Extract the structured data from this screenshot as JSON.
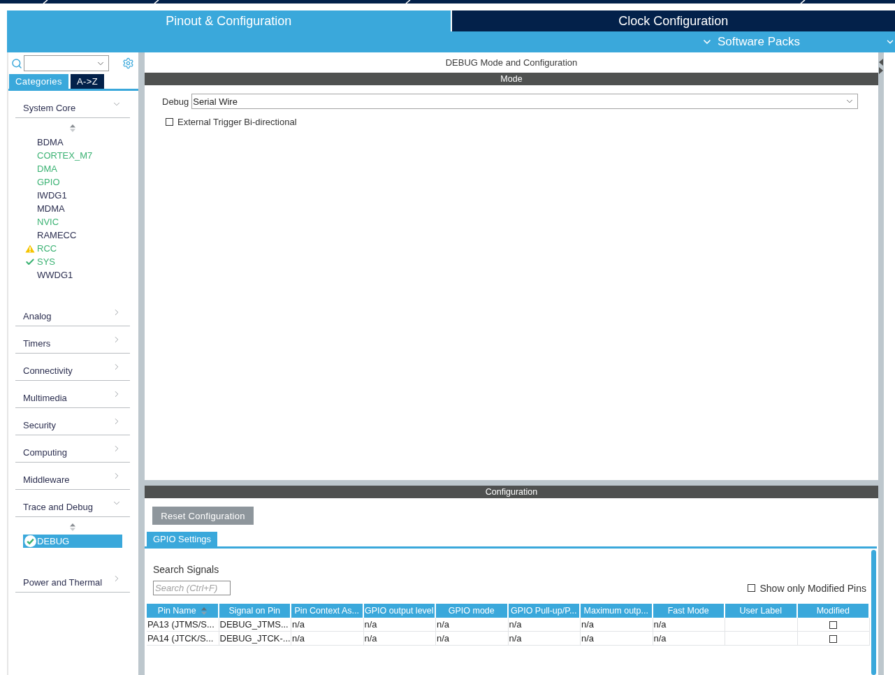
{
  "top_tabs": [
    {
      "label": "Pinout & Configuration",
      "selected": true
    },
    {
      "label": "Clock Configuration",
      "selected": false
    }
  ],
  "menu": {
    "label": "Software Packs"
  },
  "sidebar": {
    "view_tabs": [
      {
        "label": "Categories",
        "selected": true
      },
      {
        "label": "A->Z",
        "selected": false
      }
    ],
    "categories": [
      {
        "label": "System Core",
        "expanded": true,
        "children": [
          {
            "label": "BDMA",
            "configured": false,
            "warning": false,
            "check": false,
            "selected": false
          },
          {
            "label": "CORTEX_M7",
            "configured": true,
            "warning": false,
            "check": false,
            "selected": false
          },
          {
            "label": "DMA",
            "configured": true,
            "warning": false,
            "check": false,
            "selected": false
          },
          {
            "label": "GPIO",
            "configured": true,
            "warning": false,
            "check": false,
            "selected": false
          },
          {
            "label": "IWDG1",
            "configured": false,
            "warning": false,
            "check": false,
            "selected": false
          },
          {
            "label": "MDMA",
            "configured": false,
            "warning": false,
            "check": false,
            "selected": false
          },
          {
            "label": "NVIC",
            "configured": true,
            "warning": false,
            "check": false,
            "selected": false
          },
          {
            "label": "RAMECC",
            "configured": false,
            "warning": false,
            "check": false,
            "selected": false
          },
          {
            "label": "RCC",
            "configured": true,
            "warning": true,
            "check": false,
            "selected": false
          },
          {
            "label": "SYS",
            "configured": true,
            "warning": false,
            "check": true,
            "selected": false
          },
          {
            "label": "WWDG1",
            "configured": false,
            "warning": false,
            "check": false,
            "selected": false
          }
        ]
      },
      {
        "label": "Analog",
        "expanded": false
      },
      {
        "label": "Timers",
        "expanded": false
      },
      {
        "label": "Connectivity",
        "expanded": false
      },
      {
        "label": "Multimedia",
        "expanded": false
      },
      {
        "label": "Security",
        "expanded": false
      },
      {
        "label": "Computing",
        "expanded": false
      },
      {
        "label": "Middleware",
        "expanded": false
      },
      {
        "label": "Trace and Debug",
        "expanded": true,
        "children": [
          {
            "label": "DEBUG",
            "warning": false,
            "check": true,
            "selected": true
          }
        ]
      },
      {
        "label": "Power and Thermal",
        "expanded": false
      }
    ]
  },
  "panel": {
    "title": "DEBUG Mode and Configuration",
    "mode": {
      "heading": "Mode",
      "fields": [
        {
          "kind": "select",
          "label": "Debug",
          "value": "Serial Wire"
        },
        {
          "kind": "checkbox",
          "label": "External Trigger Bi-directional",
          "checked": false
        }
      ]
    },
    "configuration": {
      "heading": "Configuration",
      "reset_button": "Reset Configuration",
      "tabs": [
        {
          "label": "GPIO Settings",
          "selected": true
        }
      ],
      "search_label": "Search Signals",
      "search": {
        "placeholder": "Search (Ctrl+F)"
      },
      "show_modified": {
        "label": "Show only Modified Pins",
        "checked": false
      },
      "table": {
        "columns": [
          {
            "label": "Pin Name",
            "sorted": true
          },
          {
            "label": "Signal on Pin",
            "sorted": false
          },
          {
            "label": "Pin Context As...",
            "sorted": false
          },
          {
            "label": "GPIO output level",
            "sorted": false
          },
          {
            "label": "GPIO mode",
            "sorted": false
          },
          {
            "label": "GPIO Pull-up/P...",
            "sorted": false
          },
          {
            "label": "Maximum outp...",
            "sorted": false
          },
          {
            "label": "Fast Mode",
            "sorted": false
          },
          {
            "label": "User Label",
            "sorted": false
          },
          {
            "label": "Modified",
            "sorted": false
          }
        ],
        "rows": [
          {
            "cells": [
              "PA13 (JTMS/S...",
              "DEBUG_JTMS...",
              "n/a",
              "n/a",
              "n/a",
              "n/a",
              "n/a",
              "n/a"
            ],
            "modified": false
          },
          {
            "cells": [
              "PA14 (JTCK/S...",
              "DEBUG_JTCK-...",
              "n/a",
              "n/a",
              "n/a",
              "n/a",
              "n/a",
              "n/a"
            ],
            "modified": false
          }
        ]
      }
    }
  }
}
